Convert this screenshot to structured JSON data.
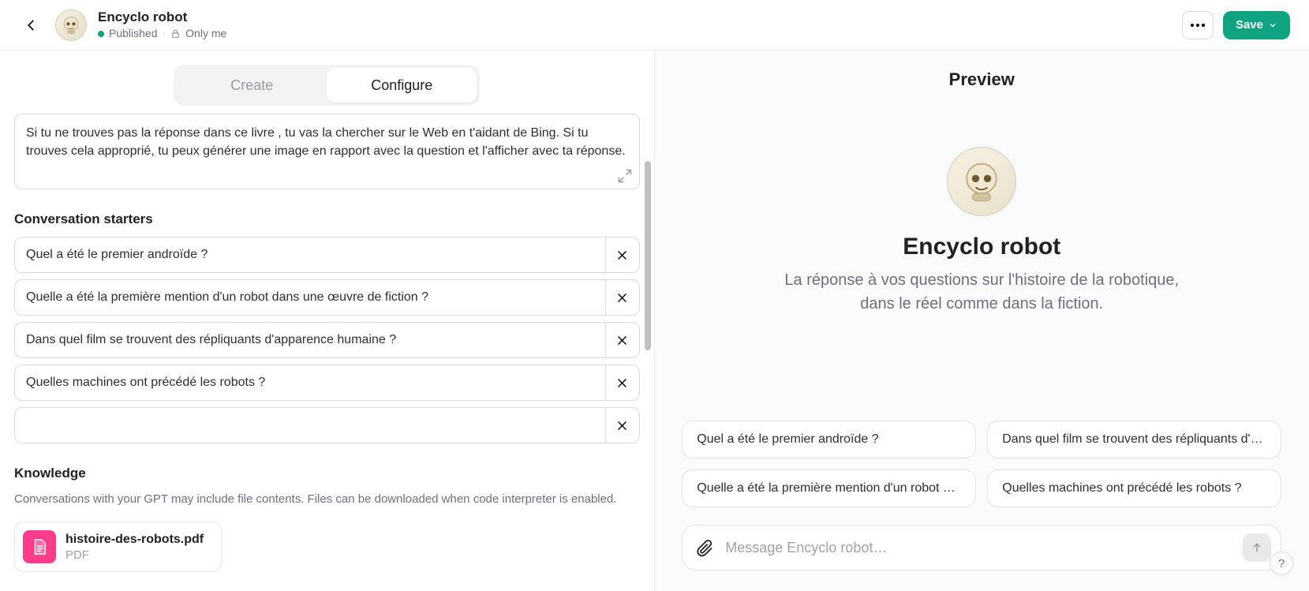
{
  "header": {
    "title": "Encyclo robot",
    "status": "Published",
    "visibility": "Only me",
    "save_label": "Save"
  },
  "tabs": {
    "create": "Create",
    "configure": "Configure",
    "active": "configure"
  },
  "instructions": {
    "visible_text": "Si tu ne trouves pas la réponse dans ce livre , tu vas la chercher sur le Web en t'aidant de Bing. Si tu trouves cela approprié, tu peux générer une image en rapport avec la question et l'afficher avec ta réponse."
  },
  "sections": {
    "starters_title": "Conversation starters",
    "knowledge_title": "Knowledge",
    "knowledge_help": "Conversations with your GPT may include file contents. Files can be downloaded when code interpreter is enabled."
  },
  "starters": {
    "items": [
      "Quel a été le premier androïde ?",
      "Quelle a été la première mention d'un robot dans une œuvre de fiction ?",
      "Dans quel film se trouvent des répliquants d'apparence humaine ?",
      "Quelles machines ont précédé les robots ?",
      ""
    ]
  },
  "knowledge": {
    "files": [
      {
        "name": "histoire-des-robots.pdf",
        "type": "PDF"
      }
    ]
  },
  "preview": {
    "heading": "Preview",
    "name": "Encyclo robot",
    "description": "La réponse à vos questions sur l'histoire de la robotique, dans le réel comme dans la fiction.",
    "starters": [
      "Quel a été le premier androïde ?",
      "Dans quel film se trouvent des répliquants d'…",
      "Quelle a été la première mention d'un robot …",
      "Quelles machines ont précédé les robots ?"
    ],
    "composer_placeholder": "Message Encyclo robot…"
  },
  "help_label": "?"
}
